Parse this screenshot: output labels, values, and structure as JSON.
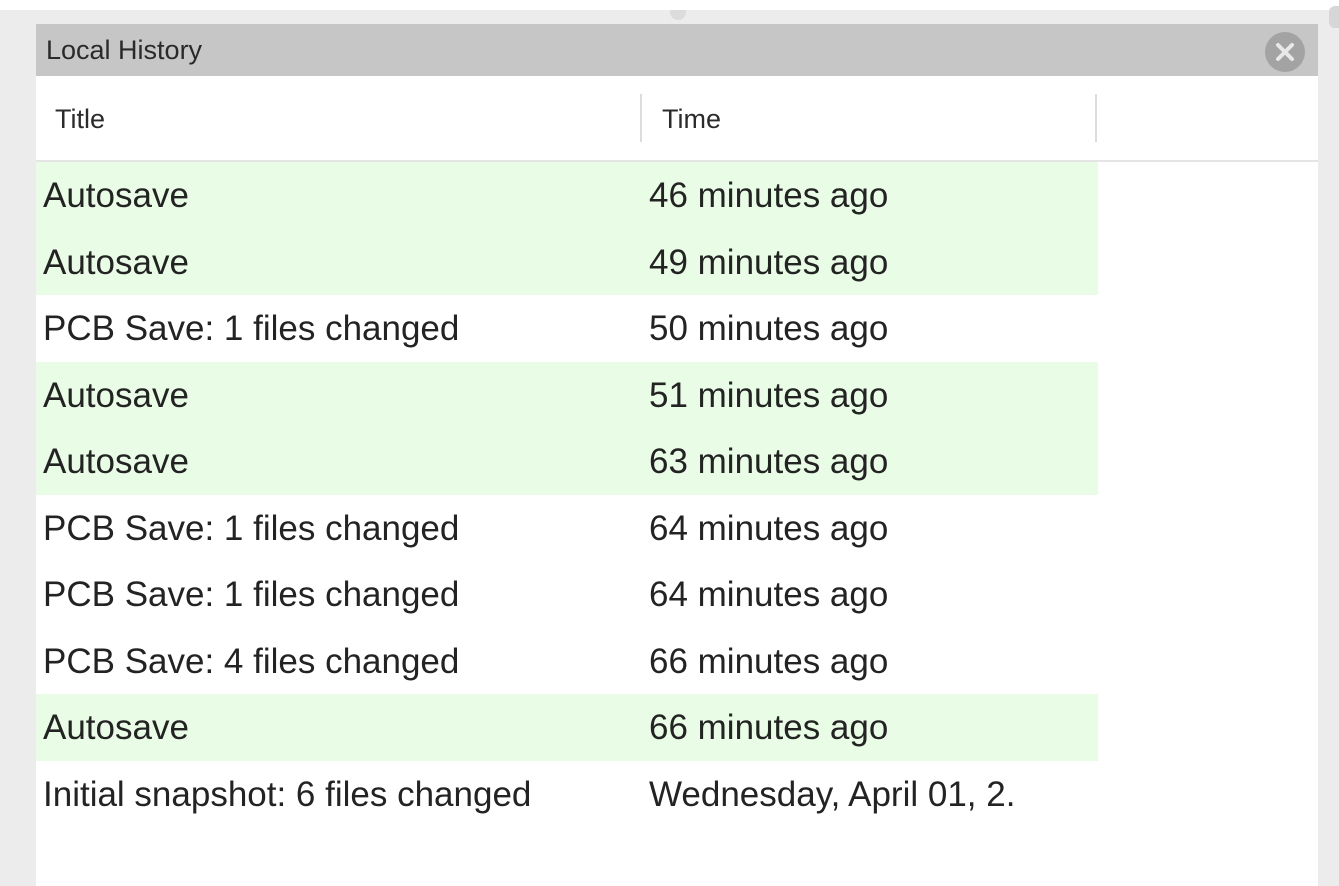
{
  "panel": {
    "title": "Local History",
    "close_icon": "close-circle-icon"
  },
  "columns": {
    "title": "Title",
    "time": "Time"
  },
  "rows": [
    {
      "title": "Autosave",
      "time": "46 minutes ago",
      "autosave": true
    },
    {
      "title": "Autosave",
      "time": "49 minutes ago",
      "autosave": true
    },
    {
      "title": "PCB Save: 1 files changed",
      "time": "50 minutes ago",
      "autosave": false
    },
    {
      "title": "Autosave",
      "time": "51 minutes ago",
      "autosave": true
    },
    {
      "title": "Autosave",
      "time": "63 minutes ago",
      "autosave": true
    },
    {
      "title": "PCB Save: 1 files changed",
      "time": "64 minutes ago",
      "autosave": false
    },
    {
      "title": "PCB Save: 1 files changed",
      "time": "64 minutes ago",
      "autosave": false
    },
    {
      "title": "PCB Save: 4 files changed",
      "time": "66 minutes ago",
      "autosave": false
    },
    {
      "title": "Autosave",
      "time": "66 minutes ago",
      "autosave": true
    },
    {
      "title": "Initial snapshot: 6 files changed",
      "time": "Wednesday, April 01, 2.",
      "autosave": false
    }
  ],
  "colors": {
    "header_bg": "#c6c6c6",
    "autosave_row_bg": "#e9fde6",
    "panel_bg": "#ffffff"
  }
}
